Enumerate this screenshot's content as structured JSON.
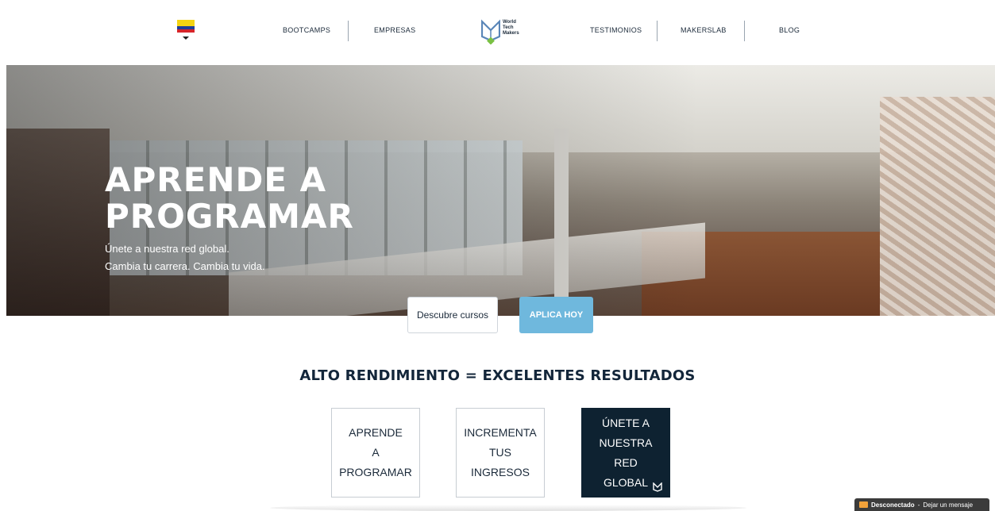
{
  "nav": {
    "links": [
      "BOOTCAMPS",
      "EMPRESAS",
      "TESTIMONIOS",
      "MAKERSLAB",
      "BLOG"
    ],
    "logo_lines": [
      "World",
      "Tech",
      "Makers"
    ],
    "flag_icon": "colombia-flag-icon"
  },
  "hero": {
    "title_line1": "APRENDE A",
    "title_line2": "PROGRAMAR",
    "subtitle_line1": "Únete a nuestra red global.",
    "subtitle_line2": "Cambia tu carrera. Cambia tu vida.",
    "btn_courses": "Descubre cursos",
    "btn_apply": "APLICA HOY"
  },
  "section": {
    "title": "ALTO RENDIMIENTO = EXCELENTES RESULTADOS",
    "cards": [
      {
        "lines": [
          "APRENDE",
          "A",
          "PROGRAMAR"
        ]
      },
      {
        "lines": [
          "INCREMENTA",
          "TUS",
          "INGRESOS"
        ]
      },
      {
        "lines": [
          "ÚNETE A",
          "NUESTRA RED",
          "GLOBAL"
        ]
      }
    ]
  },
  "chat": {
    "status": "Desconectado",
    "separator": " - ",
    "action": "Dejar un mensaje"
  },
  "colors": {
    "accent_blue": "#6fb8dd",
    "dark_navy": "#0e2231",
    "logo_green": "#7ac143"
  }
}
